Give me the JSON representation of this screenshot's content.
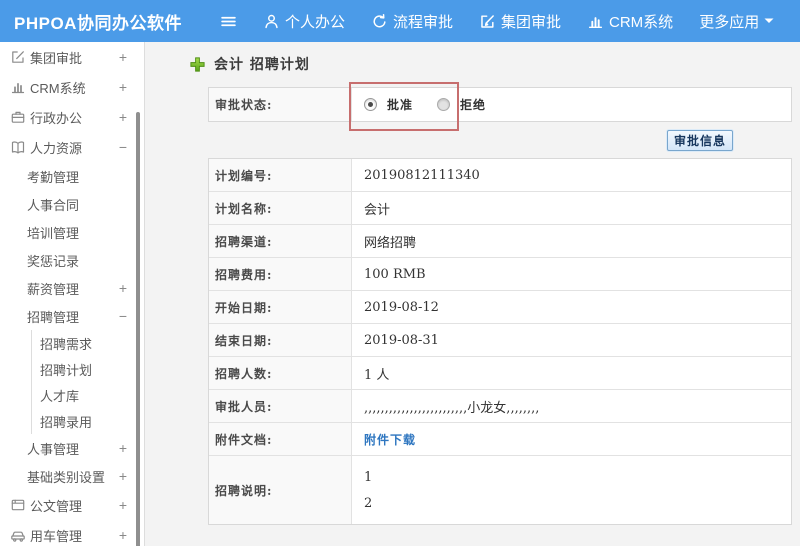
{
  "colors": {
    "topbar_blue": "#4b9be8",
    "annotation_red": "#c76e6e",
    "link_blue": "#2e76c0",
    "plus_green": "#6fb31f",
    "button_face": "#d4e6f8"
  },
  "topbar": {
    "logo": "PHPOA协同办公软件",
    "nav": [
      {
        "label": "个人办公",
        "icon": "user-icon"
      },
      {
        "label": "流程审批",
        "icon": "process-icon"
      },
      {
        "label": "集团审批",
        "icon": "edit-square-icon"
      },
      {
        "label": "CRM系统",
        "icon": "bar-chart-icon"
      },
      {
        "label": "更多应用",
        "icon": "caret-down-icon"
      }
    ]
  },
  "sidebar": {
    "items": [
      {
        "label": "集团审批",
        "toggle": "+",
        "level": 0,
        "icon": "edit-square-icon"
      },
      {
        "label": "CRM系统",
        "toggle": "+",
        "level": 0,
        "icon": "bar-chart-icon"
      },
      {
        "label": "行政办公",
        "toggle": "+",
        "level": 0,
        "icon": "briefcase-icon"
      },
      {
        "label": "人力资源",
        "toggle": "−",
        "level": 0,
        "icon": "book-icon"
      },
      {
        "label": "考勤管理",
        "level": 1
      },
      {
        "label": "人事合同",
        "level": 1
      },
      {
        "label": "培训管理",
        "level": 1
      },
      {
        "label": "奖惩记录",
        "level": 1
      },
      {
        "label": "薪资管理",
        "toggle": "+",
        "level": 1
      },
      {
        "label": "招聘管理",
        "toggle": "−",
        "level": 1
      },
      {
        "label": "招聘需求",
        "level": 2
      },
      {
        "label": "招聘计划",
        "level": 2
      },
      {
        "label": "人才库",
        "level": 2
      },
      {
        "label": "招聘录用",
        "level": 2
      },
      {
        "label": "人事管理",
        "toggle": "+",
        "level": 1
      },
      {
        "label": "基础类别设置",
        "toggle": "+",
        "level": 1
      },
      {
        "label": "公文管理",
        "toggle": "+",
        "level": 0,
        "icon": "document-icon"
      },
      {
        "label": "用车管理",
        "toggle": "+",
        "level": 0,
        "icon": "car-icon"
      }
    ]
  },
  "main": {
    "title": "会计 招聘计划",
    "approval": {
      "label": "审批状态:",
      "options": [
        {
          "label": "批准",
          "checked": true
        },
        {
          "label": "拒绝",
          "checked": false
        }
      ]
    },
    "approval_info_button": "审批信息",
    "fields": [
      {
        "label": "计划编号:",
        "value": "20190812111340"
      },
      {
        "label": "计划名称:",
        "value": "会计"
      },
      {
        "label": "招聘渠道:",
        "value": "网络招聘"
      },
      {
        "label": "招聘费用:",
        "value": "100 RMB"
      },
      {
        "label": "开始日期:",
        "value": "2019-08-12"
      },
      {
        "label": "结束日期:",
        "value": "2019-08-31"
      },
      {
        "label": "招聘人数:",
        "value": "1 人"
      },
      {
        "label": "审批人员:",
        "value": ",,,,,,,,,,,,,,,,,,,,,,,,,小龙女,,,,,,,,"
      },
      {
        "label": "附件文档:",
        "value": "附件下载"
      },
      {
        "label": "招聘说明:",
        "value": "1\n2"
      }
    ]
  }
}
